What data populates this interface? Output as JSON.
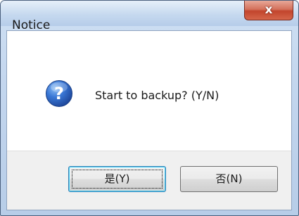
{
  "window": {
    "title": "Notice",
    "close_glyph": "x"
  },
  "message": {
    "icon": "question-icon",
    "text": "Start to backup? (Y/N)"
  },
  "buttons": {
    "yes_label": "是(Y)",
    "no_label": "否(N)"
  },
  "colors": {
    "title_bar": "#c6d9ef",
    "close_button": "#c2452d",
    "icon_blue": "#2a62c4",
    "button_area": "#f0f0f0",
    "focus_border": "#3c7fb1"
  }
}
